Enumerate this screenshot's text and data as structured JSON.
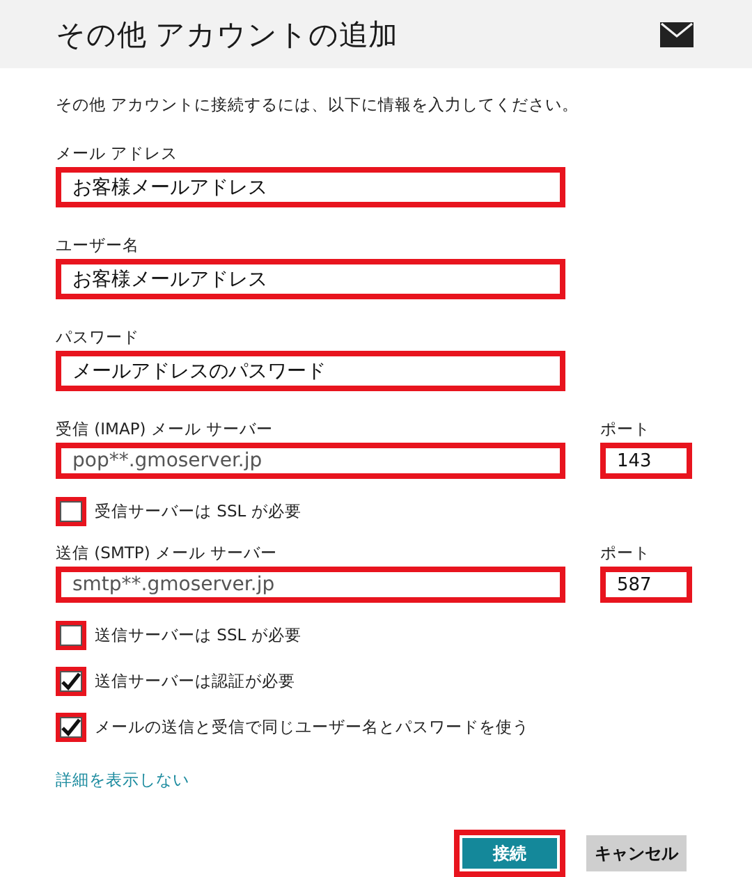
{
  "header": {
    "title": "その他 アカウントの追加"
  },
  "intro": "その他 アカウントに接続するには、以下に情報を入力してください。",
  "form": [
    {
      "kind": "field",
      "label": "メール アドレス",
      "value": "お客様メールアドレス",
      "highlighted": true
    },
    {
      "kind": "field",
      "label": "ユーザー名",
      "value": "お客様メールアドレス",
      "highlighted": true
    },
    {
      "kind": "field",
      "label": "パスワード",
      "value": "メールアドレスのパスワード",
      "highlighted": true
    },
    {
      "kind": "server",
      "label": "受信 (IMAP) メール サーバー",
      "value": "pop**.gmoserver.jp",
      "highlighted": true,
      "port_label": "ポート",
      "port_value": "143",
      "port_highlighted": true
    },
    {
      "kind": "checkbox",
      "label": "受信サーバーは SSL が必要",
      "checked": false,
      "highlighted": true
    },
    {
      "kind": "server",
      "label": "送信 (SMTP) メール サーバー",
      "value": "smtp**.gmoserver.jp",
      "highlighted": true,
      "port_label": "ポート",
      "port_value": "587",
      "port_highlighted": true
    },
    {
      "kind": "checkbox",
      "label": "送信サーバーは SSL が必要",
      "checked": false,
      "highlighted": true
    },
    {
      "kind": "checkbox",
      "label": "送信サーバーは認証が必要",
      "checked": true,
      "highlighted": true
    },
    {
      "kind": "checkbox",
      "label": "メールの送信と受信で同じユーザー名とパスワードを使う",
      "checked": true,
      "highlighted": true
    }
  ],
  "details_link": "詳細を表示しない",
  "buttons": [
    {
      "kind": "primary",
      "label": "接続",
      "highlighted": true
    },
    {
      "kind": "secondary",
      "label": "キャンセル",
      "highlighted": false
    }
  ]
}
